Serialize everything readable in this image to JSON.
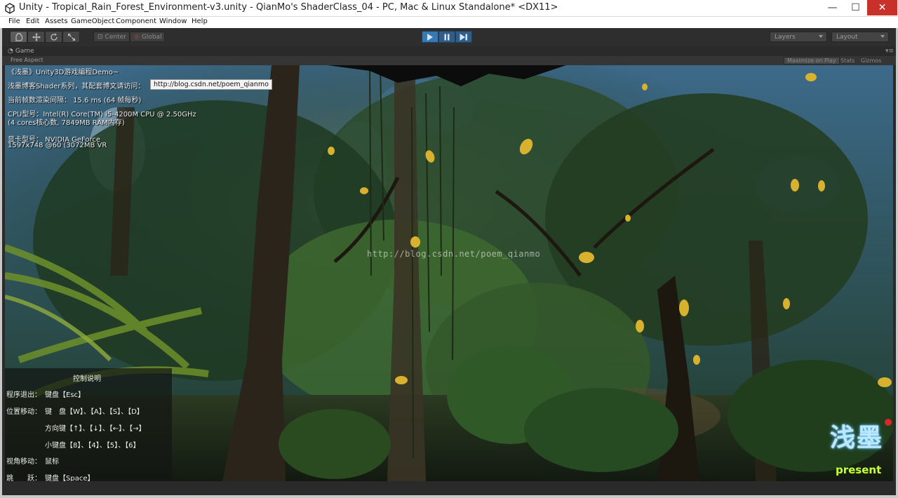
{
  "window": {
    "title": "Unity - Tropical_Rain_Forest_Environment-v3.unity - QianMo's ShaderClass_04 - PC, Mac & Linux Standalone* <DX11>",
    "minimize": "—",
    "maximize": "☐",
    "close": "✕"
  },
  "menu": [
    "File",
    "Edit",
    "Assets",
    "GameObject",
    "Component",
    "Window",
    "Help"
  ],
  "toolbar": {
    "transform_tools": [
      "hand-icon",
      "move-icon",
      "rotate-icon",
      "scale-icon"
    ],
    "pivot_center": "Center",
    "pivot_global": "Global",
    "layers": "Layers",
    "layout": "Layout",
    "play_color": "#3a78b2"
  },
  "game_view": {
    "tab_label": "Game",
    "aspect": "Free Aspect",
    "maximize_on_play": "Maximize on Play",
    "stats": "Stats",
    "gizmos": "Gizmos"
  },
  "hud": {
    "line1": "《浅墨》Unity3D游戏编程Demo~",
    "line2": "浅墨博客Shader系列，其配套博文请访问：",
    "url": "http://blog.csdn.net/poem_qianmo",
    "line3": "当前帧数渲染间隔：  15.6 ms (64 帧每秒)",
    "line4": "CPU型号：Intel(R) Core(TM) i5-4200M CPU @ 2.50GHz",
    "line5": "(4 cores核心数, 7849MB RAM内存)",
    "line6": "显卡型号：  NVIDIA GeForce",
    "line7": "1597x748 @60 (3072MB VR"
  },
  "controls": {
    "title": "控制说明",
    "exit_label": "程序退出：",
    "exit_keys": "键盘【Esc】",
    "move_label": "位置移动：",
    "move_keys1": "键　盘【W】、【A】、【S】、【D】",
    "move_keys2": "方向键【↑】、【↓】、【←】、【→】",
    "move_keys3": "小键盘【8】、【4】、【5】、【6】",
    "look_label": "视角移动：",
    "look_keys": "鼠标",
    "jump_label": "跳　　跃：",
    "jump_keys": "键盘【Space】"
  },
  "watermark": "http://blog.csdn.net/poem_qianmo",
  "logo": {
    "zh": "浅墨",
    "present": "present"
  }
}
